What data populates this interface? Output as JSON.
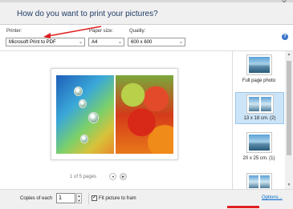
{
  "window": {
    "title": "How do you want to print your pictures?"
  },
  "toolbar": {
    "printer": {
      "label": "Printer:",
      "value": "Microsoft Print to PDF"
    },
    "paper_size": {
      "label": "Paper size:",
      "value": "A4"
    },
    "quality": {
      "label": "Quality:",
      "value": "600 x 600"
    },
    "help_glyph": "?"
  },
  "preview": {
    "pages_text": "1 of 5 pages",
    "prev_glyph": "◂",
    "next_glyph": "▸"
  },
  "layouts": [
    {
      "label": "Full page photo",
      "selected": false
    },
    {
      "label": "13 x 18 cm. (2)",
      "selected": true
    },
    {
      "label": "20 x 25 cm. (1)",
      "selected": false
    }
  ],
  "bottom": {
    "copies_label": "Copies of each",
    "copies_value": "1",
    "fit_checked": true,
    "fit_label": "Fit picture to fram",
    "options_link": "Options..."
  },
  "colors": {
    "accent_red": "#e02020",
    "title_blue": "#1f3a65",
    "selection": "#cce4f7"
  }
}
